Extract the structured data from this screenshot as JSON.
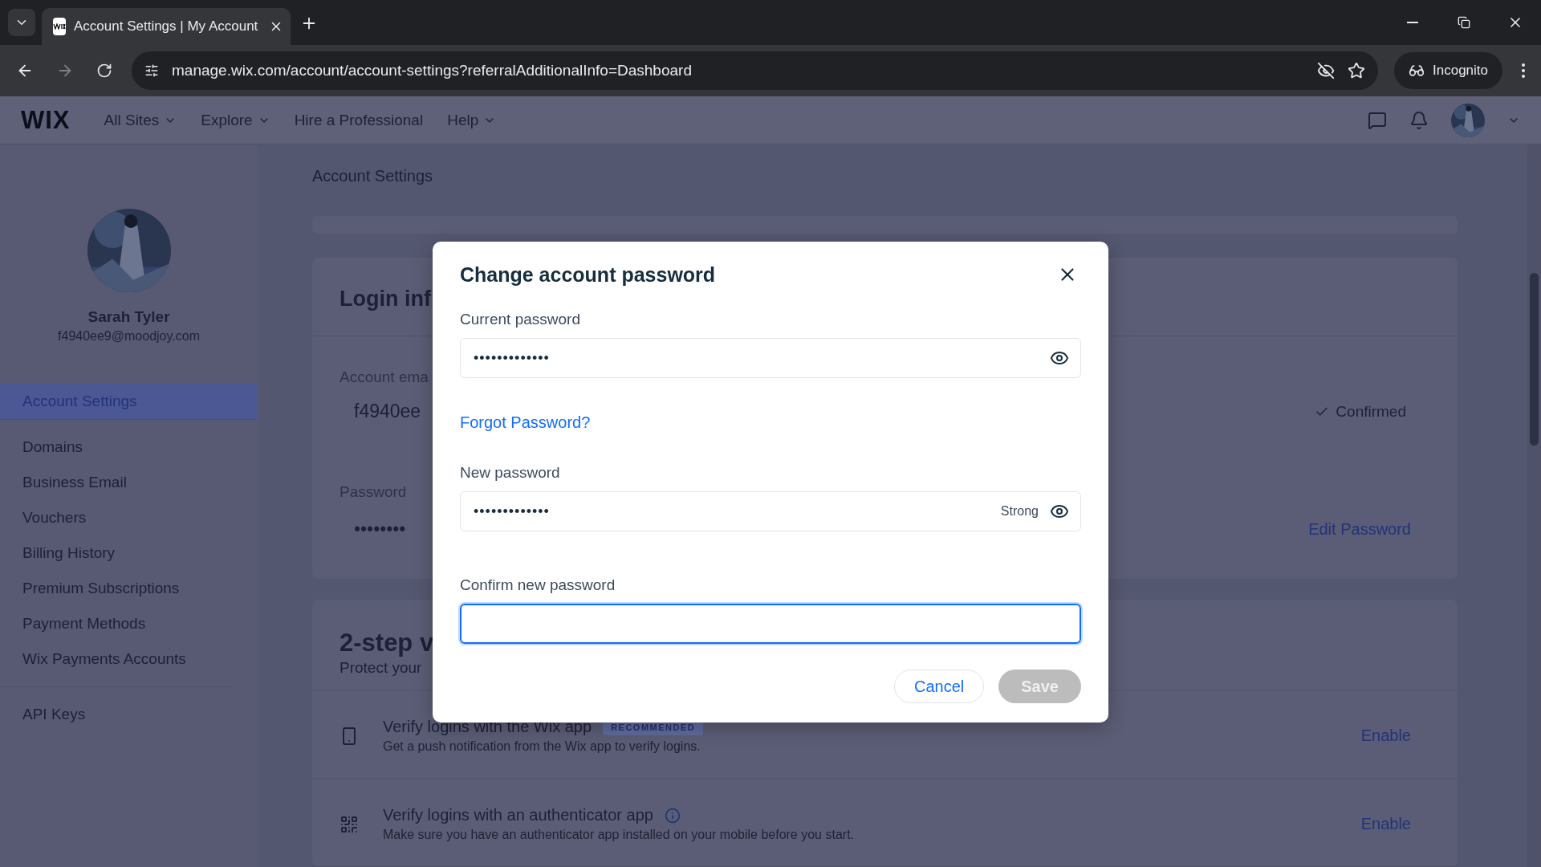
{
  "browser": {
    "tab_title": "Account Settings | My Account",
    "url": "manage.wix.com/account/account-settings?referralAdditionalInfo=Dashboard",
    "incognito_label": "Incognito"
  },
  "nav": {
    "logo": "WIX",
    "items": [
      {
        "label": "All Sites",
        "dropdown": true
      },
      {
        "label": "Explore",
        "dropdown": true
      },
      {
        "label": "Hire a Professional",
        "dropdown": false
      },
      {
        "label": "Help",
        "dropdown": true
      }
    ]
  },
  "sidebar": {
    "profile": {
      "name": "Sarah Tyler",
      "email": "f4940ee9@moodjoy.com"
    },
    "groups": [
      [
        {
          "label": "Account Settings",
          "selected": true
        }
      ],
      [
        {
          "label": "Domains",
          "selected": false
        },
        {
          "label": "Business Email",
          "selected": false
        },
        {
          "label": "Vouchers",
          "selected": false
        },
        {
          "label": "Billing History",
          "selected": false
        },
        {
          "label": "Premium Subscriptions",
          "selected": false
        },
        {
          "label": "Payment Methods",
          "selected": false
        },
        {
          "label": "Wix Payments Accounts",
          "selected": false
        }
      ],
      [
        {
          "label": "API Keys",
          "selected": false
        }
      ]
    ]
  },
  "page": {
    "title": "Account Settings",
    "login_card": {
      "title": "Login inf",
      "email_label": "Account ema",
      "email_value": "f4940ee",
      "email_status": "Confirmed",
      "password_label": "Password",
      "password_value": "••••••••",
      "edit_button": "Edit Password"
    },
    "two_step": {
      "title": "2-step v",
      "subtitle": "Protect your",
      "methods": [
        {
          "kind": "phone",
          "title": "Verify logins with the Wix app",
          "badge": "RECOMMENDED",
          "info": false,
          "description": "Get a push notification from the Wix app to verify logins.",
          "action": "Enable"
        },
        {
          "kind": "qr",
          "title": "Verify logins with an authenticator app",
          "info": true,
          "description": "Make sure you have an authenticator app installed on your mobile before you start.",
          "action": "Enable"
        }
      ]
    }
  },
  "dialog": {
    "title": "Change account password",
    "fields": [
      {
        "label": "Current password",
        "value": "•••••••••••••",
        "focused": false,
        "reveal": true
      },
      {
        "label": "New password",
        "value": "•••••••••••••",
        "strength": "Strong",
        "focused": false,
        "reveal": true
      },
      {
        "label": "Confirm new password",
        "focused": true,
        "reveal": false
      }
    ],
    "forgot_link": "Forgot Password?",
    "cancel": "Cancel",
    "save": {
      "label": "Save",
      "disabled": true
    }
  }
}
